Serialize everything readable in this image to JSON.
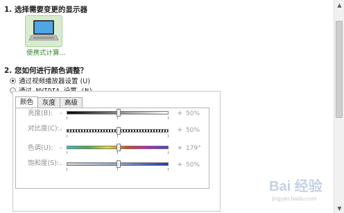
{
  "section1": {
    "title": "1. 选择需要变更的显示器"
  },
  "display": {
    "label": "便携式计算...",
    "icon": "laptop-icon"
  },
  "section2": {
    "title": "2. 您如何进行颜色调整？"
  },
  "options": [
    {
      "label_prefix": "通过视频播放器设置",
      "hotkey": "(U)",
      "selected": true
    },
    {
      "label_prefix": "通过 NVIDIA 设置",
      "hotkey": "(N)",
      "selected": false
    }
  ],
  "tabs": [
    "颜色",
    "灰度",
    "高级"
  ],
  "sliders": [
    {
      "label": "亮度(B):",
      "value": "50%",
      "level": 0.51,
      "style": "brightness"
    },
    {
      "label": "对比度(C):",
      "value": "50%",
      "level": 0.51,
      "style": "contrast"
    },
    {
      "label": "色调(U):",
      "value": "179°",
      "level": 0.51,
      "style": "hue"
    },
    {
      "label": "饱和度(S):",
      "value": "50%",
      "level": 0.51,
      "style": "saturation"
    }
  ],
  "minus_sign": "-",
  "plus_sign": "+",
  "watermark": {
    "text": "Bai 经验",
    "sub": "jingyan.baidu.com"
  },
  "colors": {
    "accent_green": "#2f8a2f",
    "panel_border": "#c9c9c9"
  }
}
